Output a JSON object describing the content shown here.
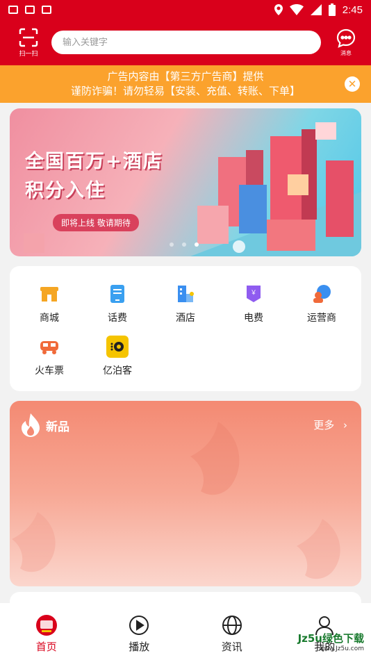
{
  "status": {
    "time": "2:45"
  },
  "header": {
    "scan_label": "扫一扫",
    "search_placeholder": "输入关键字",
    "message_label": "消息"
  },
  "notice": {
    "line1": "广告内容由【第三方广告商】提供",
    "line2": "谨防诈骗！请勿轻易【安装、充值、转账、下单】"
  },
  "banner": {
    "title_line1": "全国百万+酒店",
    "title_line2": "积分入住",
    "pill": "即将上线  敬请期待",
    "slides": 3,
    "active_slide": 3
  },
  "menu": {
    "items": [
      {
        "label": "商城",
        "icon": "shop-icon",
        "color": "#f5a623"
      },
      {
        "label": "话费",
        "icon": "phone-bill-icon",
        "color": "#3aa0f0"
      },
      {
        "label": "酒店",
        "icon": "hotel-icon",
        "color": "#3a8ff0"
      },
      {
        "label": "电费",
        "icon": "electricity-icon",
        "color": "#8f5cf0"
      },
      {
        "label": "运营商",
        "icon": "operator-icon",
        "color": "#3a8ff0"
      },
      {
        "label": "火车票",
        "icon": "train-icon",
        "color": "#f06a3a"
      },
      {
        "label": "亿泊客",
        "icon": "yibooker-icon",
        "color": "#f5c400"
      }
    ]
  },
  "new_section": {
    "title": "新品",
    "more": "更多"
  },
  "tabbar": {
    "items": [
      {
        "label": "首页",
        "icon": "home-logo-icon"
      },
      {
        "label": "播放",
        "icon": "play-icon"
      },
      {
        "label": "资讯",
        "icon": "globe-icon"
      },
      {
        "label": "我的",
        "icon": "user-icon"
      }
    ]
  },
  "watermark": {
    "line1": "Jz5u绿色下载",
    "line2": "www.Jz5u.com"
  },
  "colors": {
    "brand": "#d9001b",
    "notice": "#fba22d"
  }
}
